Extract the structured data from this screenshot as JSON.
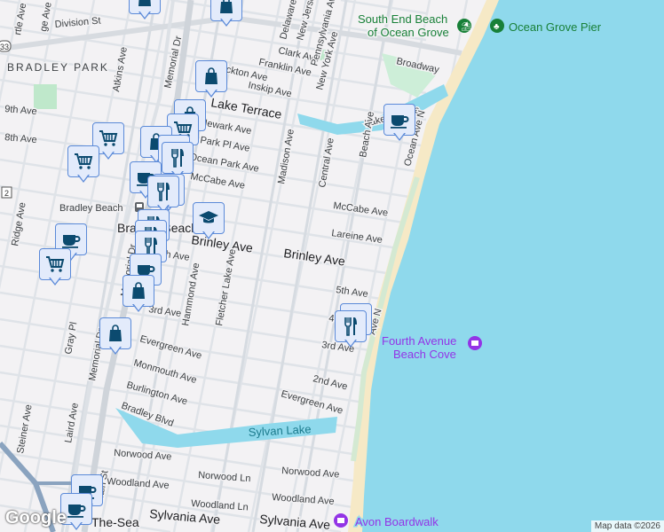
{
  "map": {
    "area_labels": {
      "bradley_park": "BRADLEY PARK",
      "bradley_beach_town": "Bradley Beach",
      "by_the_sea": "The-Sea"
    },
    "transit": {
      "bradley_beach_station": "Bradley Beach"
    },
    "pois": {
      "south_end_beach": [
        "South End Beach",
        "of Ocean Grove"
      ],
      "ocean_grove_pier": "Ocean Grove Pier",
      "fourth_avenue_beach_cove": [
        "Fourth Avenue",
        "Beach Cove"
      ],
      "avon_boardwalk": "Avon Boardwalk"
    },
    "water": {
      "sylvan_lake": "Sylvan Lake"
    },
    "route_shields": {
      "r33": "33",
      "r2": "2"
    },
    "streets": {
      "ge_ave": "ge Ave",
      "rtle_ave": "rtle Ave",
      "division_st": "Division St",
      "atkins_ave": "Atkins Ave",
      "memorial_dr_n": "Memorial Dr",
      "stockton_ave": "Stockton Ave",
      "franklin_ave": "Franklin Ave",
      "clark_ave": "Clark Ave",
      "inskip_ave": "Inskip Ave",
      "delaware": "Delaware",
      "new_jersey": "New Jersey",
      "pennsylvania": "Pennsylvania Ave",
      "new_york_ave": "New York Ave",
      "lake_terrace": "Lake Terrace",
      "lake_terrace_e": "Lake Terrace",
      "ninth_ave": "9th Ave",
      "eighth_ave": "8th Ave",
      "newark_ave": "Newark Ave",
      "park_pl_ave": "Park Pl Ave",
      "ocean_park_ave": "Ocean Park Ave",
      "mccabe_ave_w": "McCabe Ave",
      "madison_ave": "Madison Ave",
      "central_ave": "Central Ave",
      "beach_ave": "Beach Ave",
      "ocean_ave_n": "Ocean Ave N",
      "ocean_ave_n_s": "Ave N",
      "broadway": "Broadway",
      "mccabe_ave_e": "McCabe Ave",
      "lareine_ave": "Lareine Ave",
      "brinley_ave_w": "Brinley Ave",
      "brinley_ave_e": "Brinley Ave",
      "fifth_ave": "5th Ave",
      "third_ave_e": "3rd Ave",
      "third_ave_w": "3rd Ave",
      "fourth_ave": "4",
      "second_ave": "2nd Ave",
      "h_ave": "h Ave",
      "evergreen_ave_e": "Evergreen Ave",
      "evergreen_ave_w": "Evergreen Ave",
      "monmouth_ave": "Monmouth Ave",
      "burlington_ave": "Burlington Ave",
      "bradley_blvd": "Bradley Blvd",
      "norwood_ave_w": "Norwood Ave",
      "norwood_ave_e": "Norwood Ave",
      "norwood_ln": "Norwood Ln",
      "woodland_ave_w": "Woodland Ave",
      "woodland_ave_e": "Woodland Ave",
      "woodland_ln": "Woodland Ln",
      "sylvania_ave_w": "Sylvania Ave",
      "sylvania_ave_e": "Sylvania Ave",
      "main_st": "Main St",
      "memorial_dr_s": "Memorial Dr",
      "memorial_dr_c": "Memorial Dr",
      "gray_pl": "Gray Pl",
      "laird_ave": "Laird Ave",
      "steiner_ave": "Steiner Ave",
      "ridge_ave": "Ridge Ave",
      "hammond_ave": "Hammond Ave",
      "fletcher_lake_ave": "Fletcher Lake Ave"
    },
    "markers": [
      "shopping",
      "shopping",
      "shopping",
      "shopping",
      "grocery",
      "grocery",
      "grocery",
      "shopping",
      "restaurant",
      "restaurant",
      "cafe",
      "restaurant",
      "restaurant",
      "school",
      "restaurant",
      "restaurant",
      "restaurant",
      "cafe",
      "grocery",
      "cafe",
      "shopping",
      "shopping",
      "restaurant",
      "restaurant",
      "cafe",
      "cafe",
      "cafe"
    ],
    "attribution": "Map data ©2026",
    "logo": "Google"
  },
  "colors": {
    "water": "#8fd9ec",
    "sand": "#f6e9c6",
    "park": "#bfe8cb",
    "marker_fill": "#e3ebfb",
    "marker_border": "#5b8ad8",
    "icon": "#0b4a6f"
  }
}
